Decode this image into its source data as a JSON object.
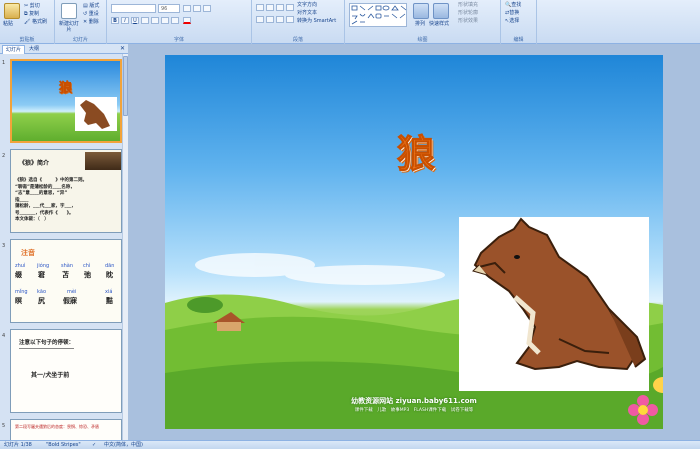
{
  "ribbon": {
    "clipboard": {
      "paste": "粘贴",
      "cut": "剪切",
      "copy": "复制",
      "format_painter": "格式刷",
      "label": "剪贴板"
    },
    "slides": {
      "new_slide": "新建幻灯片",
      "layout": "版式",
      "reset": "重设",
      "delete": "删除",
      "label": "幻灯片"
    },
    "font": {
      "size": "96",
      "label": "字体"
    },
    "paragraph": {
      "text_direction": "文字方向",
      "align_text": "对齐文本",
      "smartart": "转换为 SmartArt",
      "label": "段落"
    },
    "drawing": {
      "arrange": "排列",
      "quick_styles": "快速样式",
      "shape_fill": "形状填充",
      "shape_outline": "形状轮廓",
      "shape_effects": "形状效果",
      "label": "绘图"
    },
    "editing": {
      "find": "查找",
      "replace": "替换",
      "select": "选择",
      "label": "编辑"
    }
  },
  "panel_tabs": {
    "slides": "幻灯片",
    "outline": "大纲"
  },
  "thumbnails": [
    {
      "num": "1",
      "title": "狼"
    },
    {
      "num": "2",
      "heading": "《狼》简介",
      "lines": [
        "《狼》选自《　　　》中的第二则。",
        "“聊斋”是蒲松龄的____名称，",
        "“志”意____的意思，“异”",
        "指____",
        "蒲松龄，___代___家，字___，",
        "号_______，代表作《　　》。",
        "本文体裁：（　）"
      ]
    },
    {
      "num": "3",
      "heading": "注音",
      "pinyin": [
        "zhuì",
        "jióng",
        "shàn",
        "chì",
        "dān",
        "mǐng",
        "kāo",
        "mèi",
        "xiá"
      ],
      "chars": [
        "缀",
        "窘",
        "苫",
        "弛",
        "眈",
        "瞑",
        "尻",
        "假寐",
        "黠"
      ]
    },
    {
      "num": "4",
      "heading": "注意以下句子的停顿：",
      "sentence": "其一/犬坐于前"
    },
    {
      "num": "5",
      "text": "第二段写屠夫遇狼后的态度：畏惧、惊恐、矛盾"
    }
  ],
  "slide": {
    "title": "狼",
    "footer_site": "幼教资源网站 ziyuan.baby611.com",
    "footer_links": "课件下载　儿歌　故事MP3　FLASH课件下载　试卷下载等"
  },
  "status": {
    "slide_pos": "幻灯片 1/38",
    "theme": "\"Bold Stripes\"",
    "lang": "中文(简体，中国)"
  }
}
